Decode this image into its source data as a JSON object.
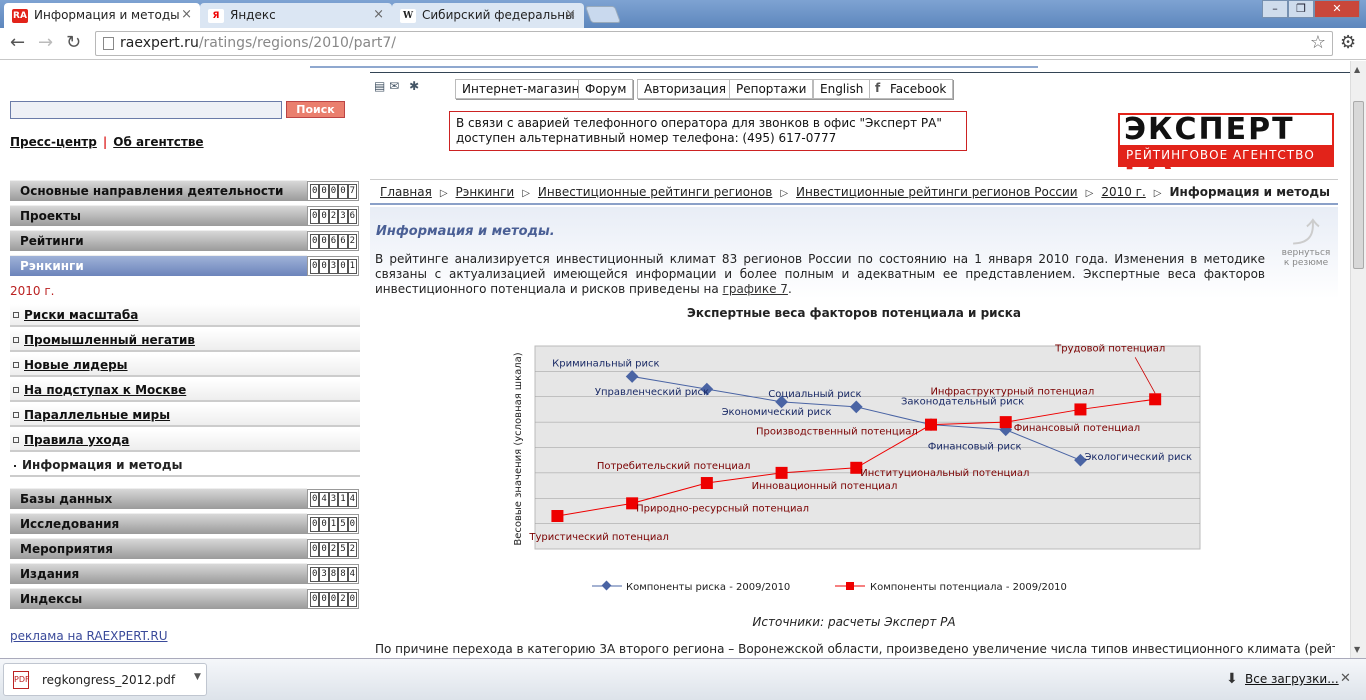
{
  "browser": {
    "tabs": [
      {
        "title": "Информация и методы",
        "icon": "RA"
      },
      {
        "title": "Яндекс",
        "icon": "Я"
      },
      {
        "title": "Сибирский федеральны",
        "icon": "W"
      }
    ],
    "url_host": "raexpert.ru",
    "url_path": "/ratings/regions/2010/part7/"
  },
  "sidebar": {
    "search_button": "Поиск",
    "press_center": "Пресс-центр",
    "about": "Об агентстве",
    "separator": "|",
    "menu": [
      {
        "label": "Основные направления деятельности",
        "count": "00007"
      },
      {
        "label": "Проекты",
        "count": "00236"
      },
      {
        "label": "Рейтинги",
        "count": "00662"
      },
      {
        "label": "Рэнкинги",
        "count": "00301"
      }
    ],
    "year": "2010 г.",
    "subitems": [
      "Риски масштаба",
      "Промышленный негатив",
      "Новые лидеры",
      "На подступах к Москве",
      "Параллельные миры",
      "Правила ухода",
      "Информация и методы"
    ],
    "menu2": [
      {
        "label": "Базы данных",
        "count": "04314"
      },
      {
        "label": "Исследования",
        "count": "00150"
      },
      {
        "label": "Мероприятия",
        "count": "00252"
      },
      {
        "label": "Издания",
        "count": "03884"
      },
      {
        "label": "Индексы",
        "count": "00020"
      }
    ],
    "ad": "реклама на RAEXPERT.RU"
  },
  "header": {
    "buttons": [
      "Интернет-магазин",
      "Форум",
      "Авторизация",
      "Репортажи",
      "English",
      "Facebook"
    ],
    "alert": "В связи с аварией телефонного оператора для звонков в офис \"Эксперт РА\" доступен альтернативный номер телефона: (495) 617-0777",
    "logo_main_a": "ЭКСПЕРТ",
    "logo_main_b": "РА",
    "logo_sub": "РЕЙТИНГОВОЕ АГЕНТСТВО"
  },
  "breadcrumb": [
    "Главная",
    "Рэнкинги",
    "Инвестиционные рейтинги регионов",
    "Инвестиционные рейтинги регионов России",
    "2010 г.",
    "Информация и методы"
  ],
  "content": {
    "title": "Информация и методы.",
    "intro": "В рейтинге анализируется инвестиционный климат 83 регионов России по состоянию на 1 января 2010 года. Изменения в методике связаны с актуализацией имеющейся информации и более полным и адекватным ее представлением. Экспертные веса факторов инвестиционного потенциала и рисков приведены на ",
    "intro_link": "графике 7",
    "intro_end": ".",
    "back": "вернуться к резюме",
    "source": "Источники: расчеты Эксперт РА",
    "para": "По причине перехода в категорию 3А второго региона – Воронежской области,  произведено увеличение числа типов инвестиционного климата (рейтинговых"
  },
  "chart_data": {
    "type": "line",
    "title": "Экспертные веса факторов потенциала и риска",
    "ylabel": "Весовые значения (условная шкала)",
    "grid": true,
    "legend_position": "bottom",
    "ylim": [
      0,
      8
    ],
    "series": [
      {
        "name": "Компоненты риска  - 2009/2010",
        "color": "#4a64a4",
        "marker": "diamond",
        "points": [
          {
            "x": 1,
            "y": 6.8,
            "label": "Криминальный риск"
          },
          {
            "x": 2,
            "y": 6.3,
            "label": "Управленческий риск"
          },
          {
            "x": 3,
            "y": 5.8,
            "label": "Экономический риск"
          },
          {
            "x": 4,
            "y": 5.6,
            "label": "Социальный риск"
          },
          {
            "x": 5,
            "y": 4.9,
            "label": "Законодательный риск"
          },
          {
            "x": 6,
            "y": 4.7,
            "label": "Финансовый риск"
          },
          {
            "x": 7,
            "y": 3.5,
            "label": "Экологический  риск"
          }
        ]
      },
      {
        "name": "Компоненты потенциала - 2009/2010",
        "color": "#ee0000",
        "marker": "square",
        "points": [
          {
            "x": 0,
            "y": 1.3,
            "label": "Туристический потенциал"
          },
          {
            "x": 1,
            "y": 1.8,
            "label": "Природно-ресурсный потенциал"
          },
          {
            "x": 2,
            "y": 2.6,
            "label": "Потребительский потенциал"
          },
          {
            "x": 3,
            "y": 3.0,
            "label": "Инновационный потенциал"
          },
          {
            "x": 4,
            "y": 3.2,
            "label": "Институциональный потенциал"
          },
          {
            "x": 5,
            "y": 4.9,
            "label": "Производственный потенциал"
          },
          {
            "x": 6,
            "y": 5.0,
            "label": "Финансовый потенциал"
          },
          {
            "x": 7,
            "y": 5.5,
            "label": "Инфраструктурный  потенциал"
          },
          {
            "x": 8,
            "y": 5.9,
            "label": "Трудовой потенциал"
          }
        ]
      }
    ]
  },
  "downloads": {
    "file": "regkongress_2012.pdf",
    "all": "Все загрузки..."
  }
}
